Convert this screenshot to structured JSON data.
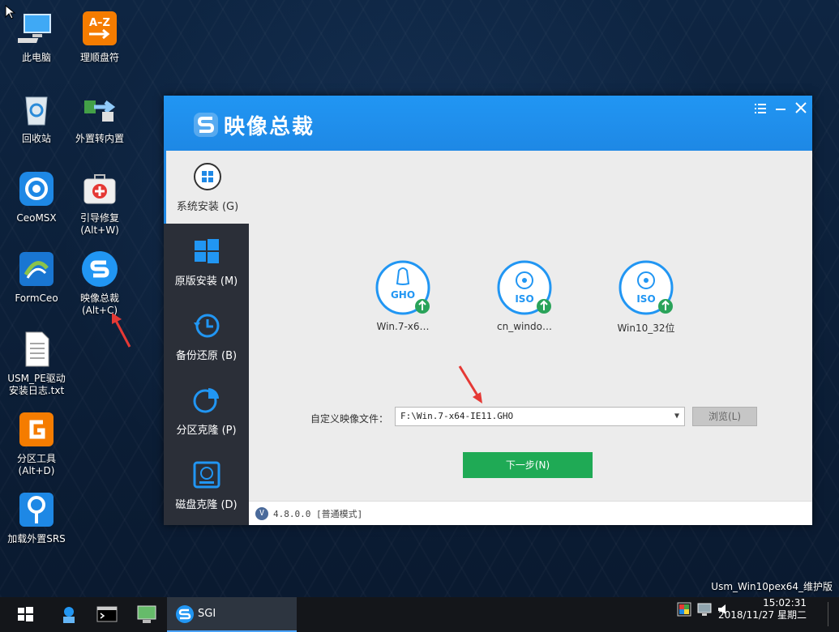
{
  "desktop": {
    "icons": [
      {
        "label": "此电脑",
        "icon": "computer-icon"
      },
      {
        "label": "理顺盘符",
        "icon": "az-sort-icon"
      },
      {
        "label": "回收站",
        "icon": "recycle-bin-icon"
      },
      {
        "label": "外置转内置",
        "icon": "transfer-icon"
      },
      {
        "label": "CeoMSX",
        "icon": "ceomsx-icon"
      },
      {
        "label": "引导修复",
        "sublabel": "(Alt+W)",
        "icon": "first-aid-icon"
      },
      {
        "label": "FormCeo",
        "icon": "formceo-icon"
      },
      {
        "label": "映像总裁",
        "sublabel": "(Alt+C)",
        "icon": "sgi-icon"
      },
      {
        "label": "USM_PE驱动",
        "sublabel": "安装日志.txt",
        "icon": "text-file-icon"
      },
      {
        "label": "分区工具",
        "sublabel": "(Alt+D)",
        "icon": "diskgenius-icon"
      },
      {
        "label": "加载外置SRS",
        "icon": "srs-icon"
      }
    ]
  },
  "app": {
    "title": "映像总裁",
    "nav": [
      {
        "label": "系统安装 (G)",
        "icon": "windows-disc-icon",
        "active": true
      },
      {
        "label": "原版安装 (M)",
        "icon": "windows-logo-icon",
        "active": false
      },
      {
        "label": "备份还原 (B)",
        "icon": "restore-clock-icon",
        "active": false
      },
      {
        "label": "分区克隆 (P)",
        "icon": "pie-chart-icon",
        "active": false
      },
      {
        "label": "磁盘克隆 (D)",
        "icon": "disk-icon",
        "active": false
      }
    ],
    "images": [
      {
        "label": "Win.7-x6…",
        "type": "GHO"
      },
      {
        "label": "cn_windo…",
        "type": "ISO"
      },
      {
        "label": "Win10_32位",
        "type": "ISO"
      }
    ],
    "custom_label": "自定义映像文件：",
    "path_value": "F:\\Win.7-x64-IE11.GHO",
    "browse_label": "浏览(L)",
    "next_label": "下一步(N)",
    "version_badge": "V",
    "version_text": "4.8.0.0 [普通模式]"
  },
  "taskbar": {
    "sgi_label": "SGI",
    "time": "15:02:31",
    "date": "2018/11/27 星期二"
  },
  "os_label": "Usm_Win10pex64_维护版",
  "colors": {
    "accent": "#1e88e5",
    "next": "#1faa55",
    "sidebar": "#2b2f38"
  }
}
